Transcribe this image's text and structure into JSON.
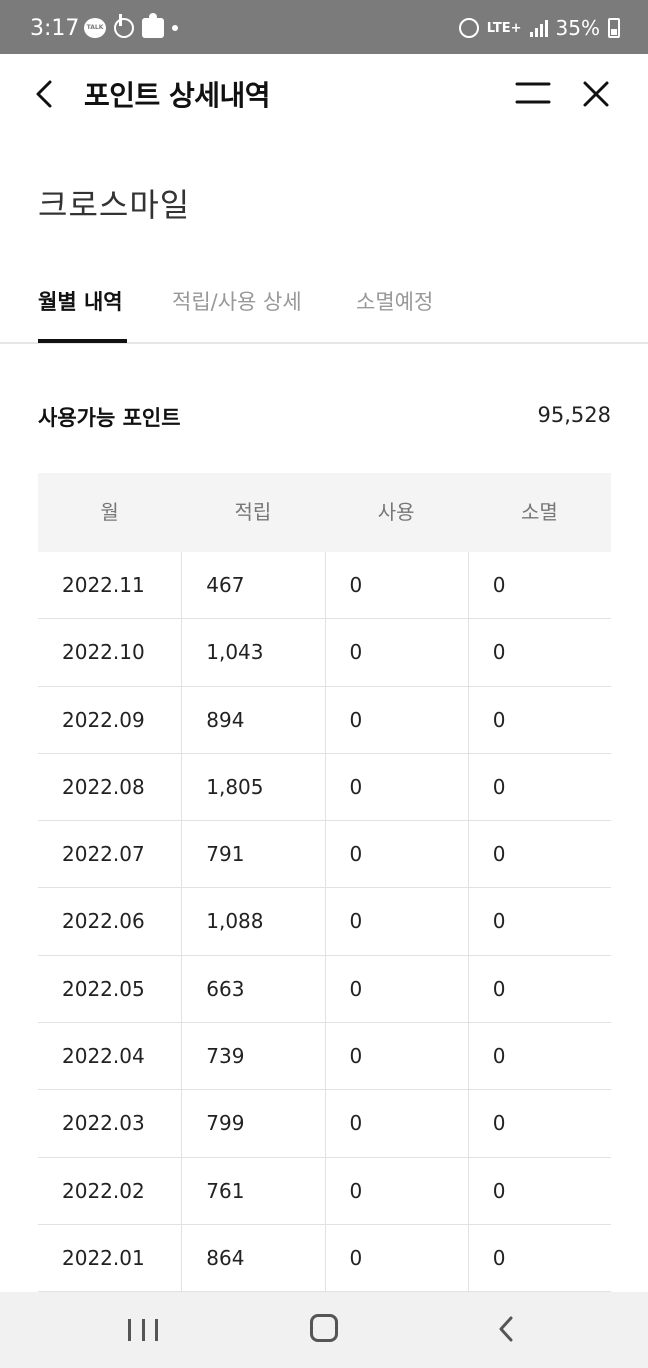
{
  "status_bar": {
    "time": "3:17",
    "talk_badge": "TALK",
    "lte": "LTE+",
    "battery": "35%"
  },
  "header": {
    "title": "포인트 상세내역"
  },
  "brand": "크로스마일",
  "tabs": [
    {
      "label": "월별 내역",
      "active": true
    },
    {
      "label": "적립/사용 상세",
      "active": false
    },
    {
      "label": "소멸예정",
      "active": false
    }
  ],
  "summary": {
    "label": "사용가능 포인트",
    "value": "95,528"
  },
  "table": {
    "headers": [
      "월",
      "적립",
      "사용",
      "소멸"
    ],
    "rows": [
      [
        "2022.11",
        "467",
        "0",
        "0"
      ],
      [
        "2022.10",
        "1,043",
        "0",
        "0"
      ],
      [
        "2022.09",
        "894",
        "0",
        "0"
      ],
      [
        "2022.08",
        "1,805",
        "0",
        "0"
      ],
      [
        "2022.07",
        "791",
        "0",
        "0"
      ],
      [
        "2022.06",
        "1,088",
        "0",
        "0"
      ],
      [
        "2022.05",
        "663",
        "0",
        "0"
      ],
      [
        "2022.04",
        "739",
        "0",
        "0"
      ],
      [
        "2022.03",
        "799",
        "0",
        "0"
      ],
      [
        "2022.02",
        "761",
        "0",
        "0"
      ],
      [
        "2022.01",
        "864",
        "0",
        "0"
      ]
    ]
  }
}
